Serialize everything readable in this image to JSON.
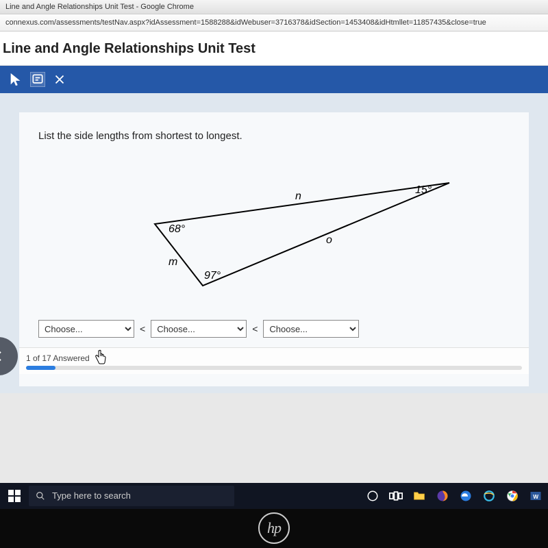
{
  "window_title": "Line and Angle Relationships Unit Test - Google Chrome",
  "url": "connexus.com/assessments/testNav.aspx?idAssessment=1588288&idWebuser=3716378&idSection=1453408&idHtmllet=11857435&close=true",
  "page_title": "Line and Angle Relationships Unit Test",
  "question": {
    "prompt": "List the side lengths from shortest to longest.",
    "triangle": {
      "angles": {
        "left": "68°",
        "bottom": "97°",
        "right": "15°"
      },
      "sides": {
        "left_short": "m",
        "top": "n",
        "hypotenuse": "o"
      }
    },
    "answer_placeholder": "Choose...",
    "lt": "<"
  },
  "progress": {
    "text": "1 of 17 Answered"
  },
  "taskbar": {
    "search_placeholder": "Type here to search",
    "hp": "hp"
  }
}
